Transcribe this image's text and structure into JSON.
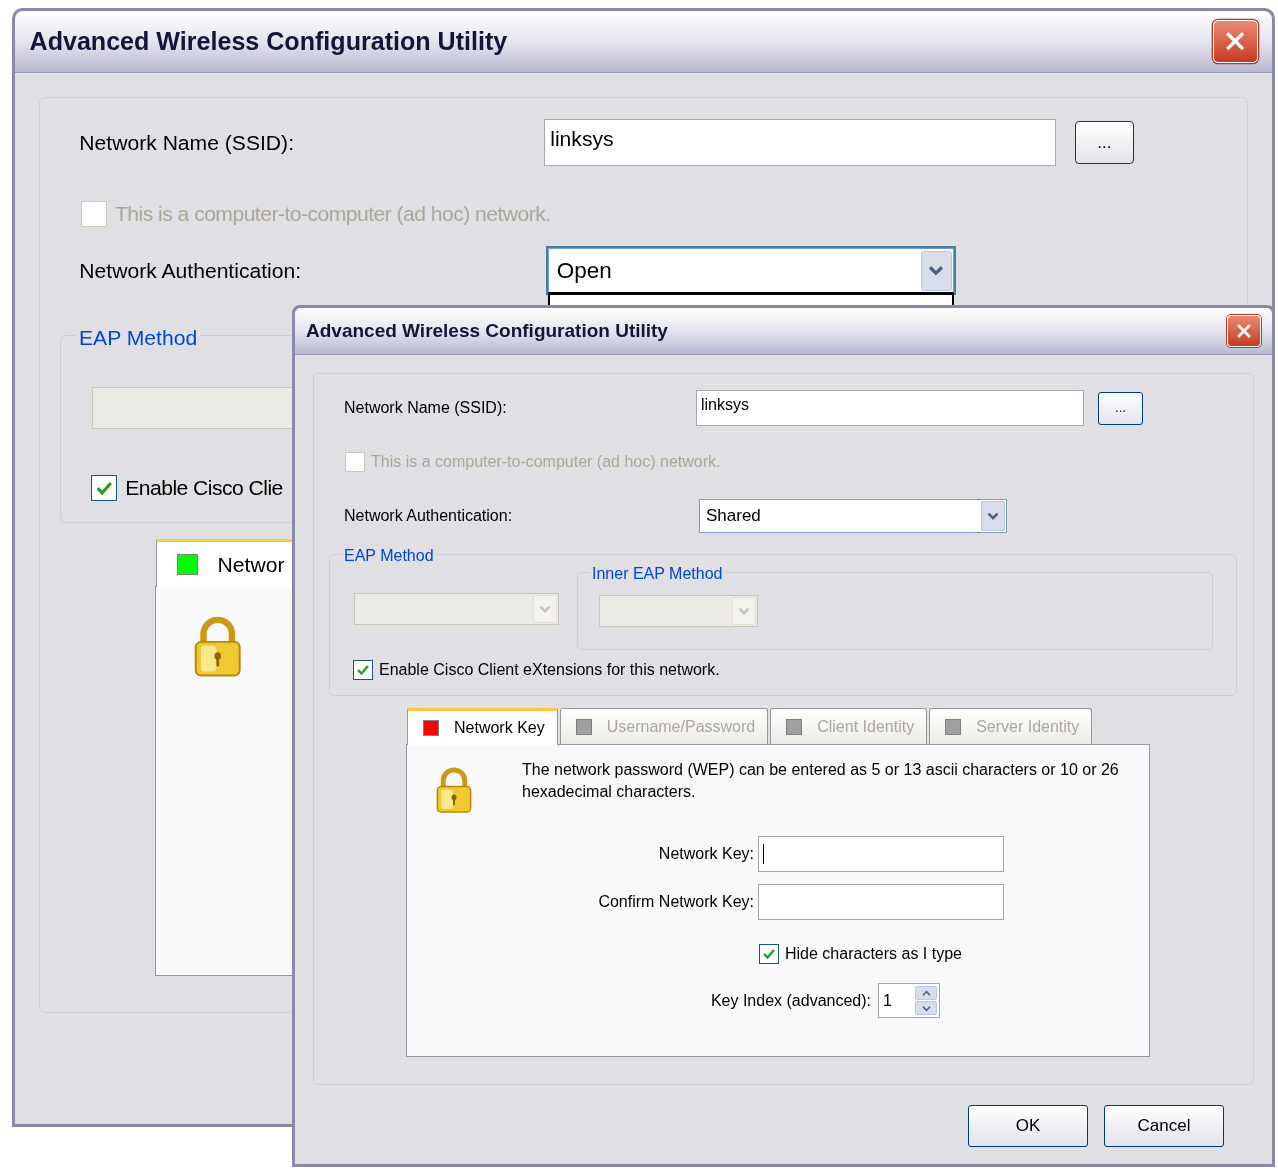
{
  "back_window": {
    "title": "Advanced Wireless Configuration Utility",
    "ssid_label": "Network Name (SSID):",
    "ssid_value": "linksys",
    "browse_button": "...",
    "adhoc": {
      "label": "This is a computer-to-computer (ad hoc) network.",
      "checked": false,
      "disabled": true
    },
    "auth_label": "Network Authentication:",
    "auth_value": "Open",
    "auth_expanded": true,
    "eap_legend": "EAP Method",
    "eap_combo": {
      "disabled": true
    },
    "cisco": {
      "label": "Enable Cisco Clie",
      "checked": true,
      "disabled": false
    },
    "tabs": [
      {
        "label": "Networ",
        "color": "#00ff00",
        "selected": true,
        "disabled": false
      }
    ]
  },
  "front_window": {
    "title": "Advanced Wireless Configuration Utility",
    "ssid_label": "Network Name (SSID):",
    "ssid_value": "linksys",
    "browse_button": "...",
    "adhoc": {
      "label": "This is a computer-to-computer (ad hoc) network.",
      "checked": false,
      "disabled": true
    },
    "auth_label": "Network Authentication:",
    "auth_value": "Shared",
    "auth_expanded": false,
    "eap_legend": "EAP Method",
    "eap_combo": {
      "disabled": true
    },
    "inner_eap_legend": "Inner EAP Method",
    "inner_eap_combo": {
      "disabled": true
    },
    "cisco": {
      "label": "Enable Cisco Client eXtensions for this network.",
      "checked": true,
      "disabled": false
    },
    "tabs": [
      {
        "label": "Network Key",
        "color": "#ff0000",
        "selected": true,
        "disabled": false
      },
      {
        "label": "Username/Password",
        "color": "#a0a0a0",
        "selected": false,
        "disabled": true
      },
      {
        "label": "Client Identity",
        "color": "#a0a0a0",
        "selected": false,
        "disabled": true
      },
      {
        "label": "Server Identity",
        "color": "#a0a0a0",
        "selected": false,
        "disabled": true
      }
    ],
    "description": "The network password (WEP) can be entered as 5 or 13 ascii characters or 10 or 26 hexadecimal characters.",
    "network_key": {
      "label": "Network Key:",
      "focused": true
    },
    "confirm_key": {
      "label": "Confirm Network Key:",
      "focused": false
    },
    "hide_chars": {
      "label": "Hide characters as I type",
      "checked": true,
      "disabled": false
    },
    "key_index": {
      "label": "Key Index (advanced):",
      "value": "1"
    },
    "buttons": [
      "OK",
      "Cancel"
    ]
  }
}
